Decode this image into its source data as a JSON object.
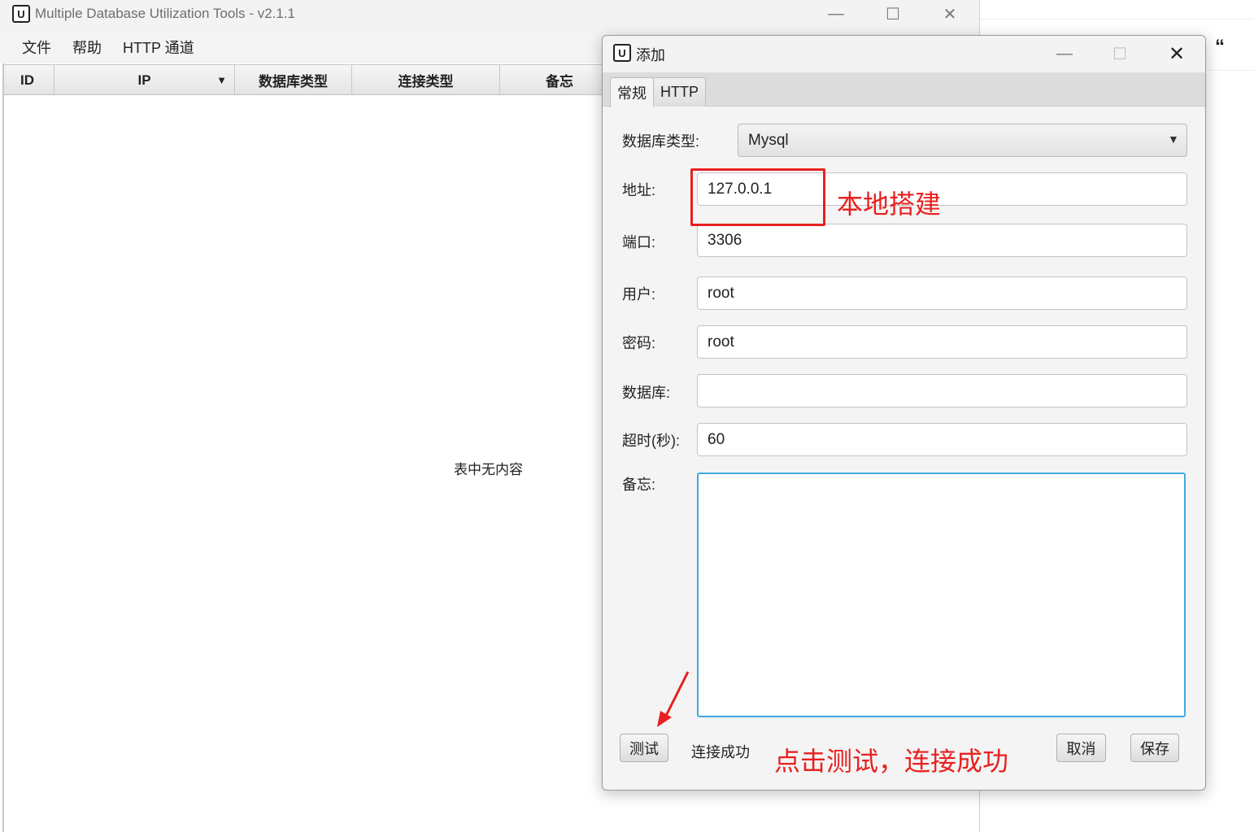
{
  "background": {
    "quote_glyph": "“"
  },
  "main_window": {
    "title": "Multiple Database Utilization Tools - v2.1.1",
    "icon_glyph": "U",
    "controls": {
      "minimize": "—",
      "maximize": "☐",
      "close": "✕"
    },
    "menu": [
      "文件",
      "帮助",
      "HTTP 通道"
    ],
    "table": {
      "columns": [
        "ID",
        "IP",
        "数据库类型",
        "连接类型",
        "备忘"
      ],
      "sort_indicator": "▼",
      "empty_text": "表中无内容"
    }
  },
  "dialog": {
    "title": "添加",
    "icon_glyph": "U",
    "controls": {
      "minimize": "—",
      "maximize": "☐",
      "close": "✕"
    },
    "tabs": [
      "常规",
      "HTTP"
    ],
    "active_tab": "常规",
    "fields": {
      "db_type": {
        "label": "数据库类型:",
        "value": "Mysql",
        "arrow": "▼"
      },
      "address": {
        "label": "地址:",
        "value": "127.0.0.1"
      },
      "port": {
        "label": "端口:",
        "value": "3306"
      },
      "user": {
        "label": "用户:",
        "value": "root"
      },
      "password": {
        "label": "密码:",
        "value": "root"
      },
      "database": {
        "label": "数据库:",
        "value": ""
      },
      "timeout": {
        "label": "超时(秒):",
        "value": "60"
      },
      "remark": {
        "label": "备忘:",
        "value": ""
      }
    },
    "buttons": {
      "test": "测试",
      "cancel": "取消",
      "save": "保存"
    },
    "status": "连接成功"
  },
  "annotations": {
    "address_note": "本地搭建",
    "test_note": "点击测试，连接成功",
    "color": "#e82020"
  },
  "colors": {
    "focus_border": "#3fa9e0",
    "success_accent": "#2eb872"
  }
}
